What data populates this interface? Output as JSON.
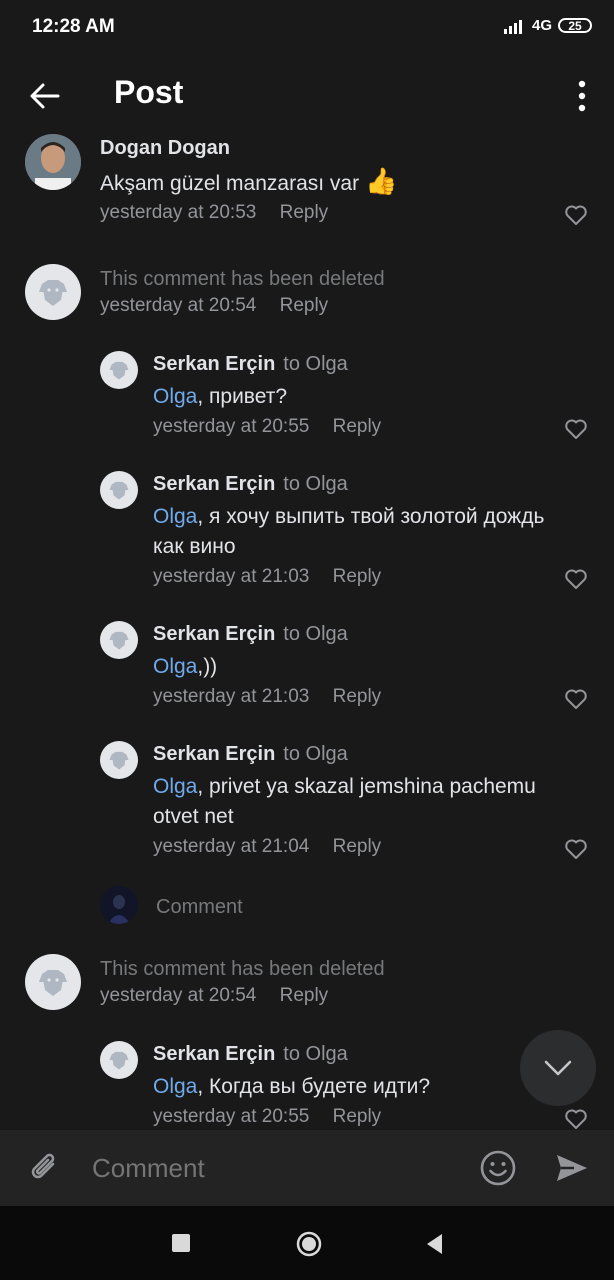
{
  "status_bar": {
    "time": "12:28 AM",
    "network": "4G",
    "battery": "25"
  },
  "app_bar": {
    "title": "Post",
    "back_icon": "arrow-left-icon",
    "more_icon": "more-vertical-icon"
  },
  "comments": [
    {
      "author": "Dogan Dogan",
      "text": "Akşam güzel manzarası var",
      "emoji": "👍",
      "time": "yesterday at 20:53",
      "reply": "Reply",
      "avatar": "photo"
    },
    {
      "deleted": "This comment has been deleted",
      "time": "yesterday at 20:54",
      "reply": "Reply",
      "avatar": "deactivated-dog-icon"
    },
    {
      "author": "Serkan Erçin",
      "to": "to Olga",
      "mention": "Olga",
      "text": ", привет?",
      "time": "yesterday at 20:55",
      "reply": "Reply"
    },
    {
      "author": "Serkan Erçin",
      "to": "to Olga",
      "mention": "Olga",
      "text": ", я хочу выпить твой золотой дождь как вино",
      "time": "yesterday at 21:03",
      "reply": "Reply"
    },
    {
      "author": "Serkan Erçin",
      "to": "to Olga",
      "mention": "Olga",
      "text": ",))",
      "time": "yesterday at 21:03",
      "reply": "Reply"
    },
    {
      "author": "Serkan Erçin",
      "to": "to Olga",
      "mention": "Olga",
      "text": ", privet ya skazal jemshina pachemu otvet net",
      "time": "yesterday at 21:04",
      "reply": "Reply"
    },
    {
      "add_comment": "Comment"
    },
    {
      "deleted": "This comment has been deleted",
      "time": "yesterday at 20:54",
      "reply": "Reply"
    },
    {
      "author": "Serkan Erçin",
      "to": "to Olga",
      "mention": "Olga",
      "text": ", Когда вы будете идти?",
      "time": "yesterday at 20:55",
      "reply": "Reply"
    }
  ],
  "composer": {
    "placeholder": "Comment"
  },
  "colors": {
    "background": "#19191a",
    "mention": "#71aaeb",
    "secondary": "#939599"
  }
}
